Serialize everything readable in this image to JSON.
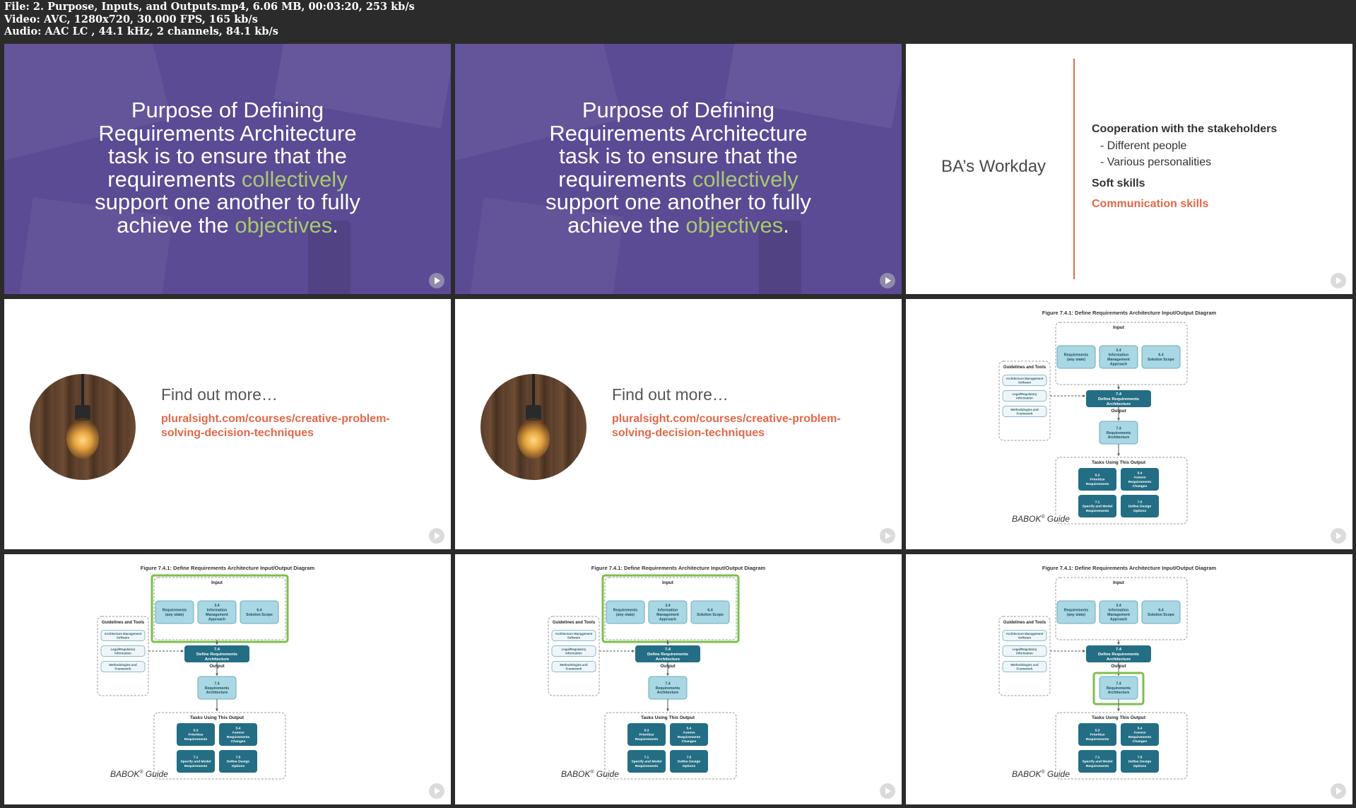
{
  "header": {
    "file_line": "File: 2. Purpose, Inputs, and Outputs.mp4, 6.06 MB, 00:03:20, 253 kb/s",
    "video_line": "Video: AVC, 1280x720, 30.000 FPS, 165 kb/s",
    "audio_line": "Audio: AAC LC , 44.1 kHz, 2 channels, 84.1 kb/s"
  },
  "purpose_slide": {
    "lines": [
      "Purpose of Defining",
      "Requirements Architecture",
      "task is to ensure that the"
    ],
    "line4_pre": "requirements ",
    "line4_hl": "collectively",
    "line5": "support one another to fully",
    "line6_pre": "achieve the ",
    "line6_hl": "objectives",
    "line6_post": "."
  },
  "workday_slide": {
    "title": "BA’s Workday",
    "heading": "Cooperation with the stakeholders",
    "bullets": [
      "-  Different people",
      "-  Various personalities"
    ],
    "soft": "Soft skills",
    "comm": "Communication skills"
  },
  "find_more": {
    "title": "Find out more…",
    "link1": "pluralsight.com/courses/creative-problem-",
    "link2": "solving-decision-techniques"
  },
  "diagram": {
    "caption": "Figure 7.4.1: Define Requirements Architecture Input/Output Diagram",
    "input_label": "Input",
    "inputs": [
      {
        "lines": [
          "Requirements",
          "(any state)"
        ]
      },
      {
        "lines": [
          "3.4",
          "Information",
          "Management",
          "Approach"
        ]
      },
      {
        "lines": [
          "6.4",
          "Solution Scope"
        ]
      }
    ],
    "guidelines_label": "Guidelines and Tools",
    "guidelines": [
      {
        "lines": [
          "Architecture Management",
          "Software"
        ]
      },
      {
        "lines": [
          "Legal/Regulatory",
          "Information"
        ]
      },
      {
        "lines": [
          "Methodologies and",
          "Framework"
        ]
      }
    ],
    "task": {
      "lines": [
        "7.4",
        "Define Requirements",
        "Architecture"
      ]
    },
    "output_label": "Output",
    "output": {
      "lines": [
        "7.4",
        "Requirements",
        "Architecture"
      ]
    },
    "tasks_label": "Tasks Using This Output",
    "tasks": [
      {
        "lines": [
          "5.3",
          "Prioritize",
          "Requirements"
        ]
      },
      {
        "lines": [
          "5.4",
          "Assess",
          "Requirements",
          "Changes"
        ]
      },
      {
        "lines": [
          "7.1",
          "Specify and Model",
          "Requirements"
        ]
      },
      {
        "lines": [
          "7.5",
          "Define Design",
          "Options"
        ]
      }
    ],
    "babok_pre": "BABOK",
    "babok_sup": "®",
    "babok_post": " Guide"
  },
  "tiles": [
    {
      "kind": "purpose"
    },
    {
      "kind": "purpose"
    },
    {
      "kind": "workday"
    },
    {
      "kind": "find_more"
    },
    {
      "kind": "find_more"
    },
    {
      "kind": "diagram",
      "highlight": "none"
    },
    {
      "kind": "diagram",
      "highlight": "input"
    },
    {
      "kind": "diagram",
      "highlight": "input"
    },
    {
      "kind": "diagram",
      "highlight": "output"
    }
  ],
  "colors": {
    "purple_bg": "#5b4a94",
    "accent_green": "#a8c96f",
    "accent_orange": "#e0684a",
    "diagram_light": "#a9d7e4",
    "diagram_dark": "#236e84",
    "highlight_green": "#7cc04a"
  }
}
